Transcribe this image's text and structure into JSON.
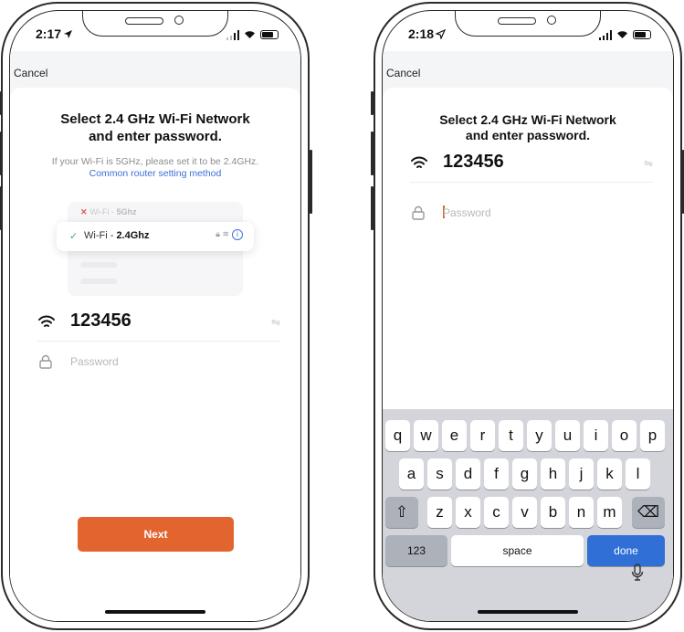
{
  "left_screen": {
    "status": {
      "time": "2:17"
    },
    "cancel_label": "Cancel",
    "title_line1": "Select 2.4 GHz Wi-Fi Network",
    "title_line2": "and enter password.",
    "hint": "If your Wi-Fi is 5GHz, please set it to be 2.4GHz.",
    "link": "Common router setting method",
    "illustration": {
      "row_5ghz_prefix": "Wi-Fi - ",
      "row_5ghz_band": "5Ghz",
      "row_24ghz_prefix": "Wi-Fi - ",
      "row_24ghz_band": "2.4Ghz"
    },
    "ssid": "123456",
    "password_placeholder": "Password",
    "next_label": "Next"
  },
  "right_screen": {
    "status": {
      "time": "2:18"
    },
    "cancel_label": "Cancel",
    "title_line1": "Select 2.4 GHz Wi-Fi Network",
    "title_line2": "and enter password.",
    "ssid": "123456",
    "password_placeholder": "Password",
    "keyboard": {
      "row1": [
        "q",
        "w",
        "e",
        "r",
        "t",
        "y",
        "u",
        "i",
        "o",
        "p"
      ],
      "row2": [
        "a",
        "s",
        "d",
        "f",
        "g",
        "h",
        "j",
        "k",
        "l"
      ],
      "row3": [
        "z",
        "x",
        "c",
        "v",
        "b",
        "n",
        "m"
      ],
      "numbers_label": "123",
      "space_label": "space",
      "done_label": "done"
    }
  },
  "colors": {
    "accent": "#e2642e",
    "link": "#3a6fd8",
    "done_key": "#2f6fd6"
  }
}
